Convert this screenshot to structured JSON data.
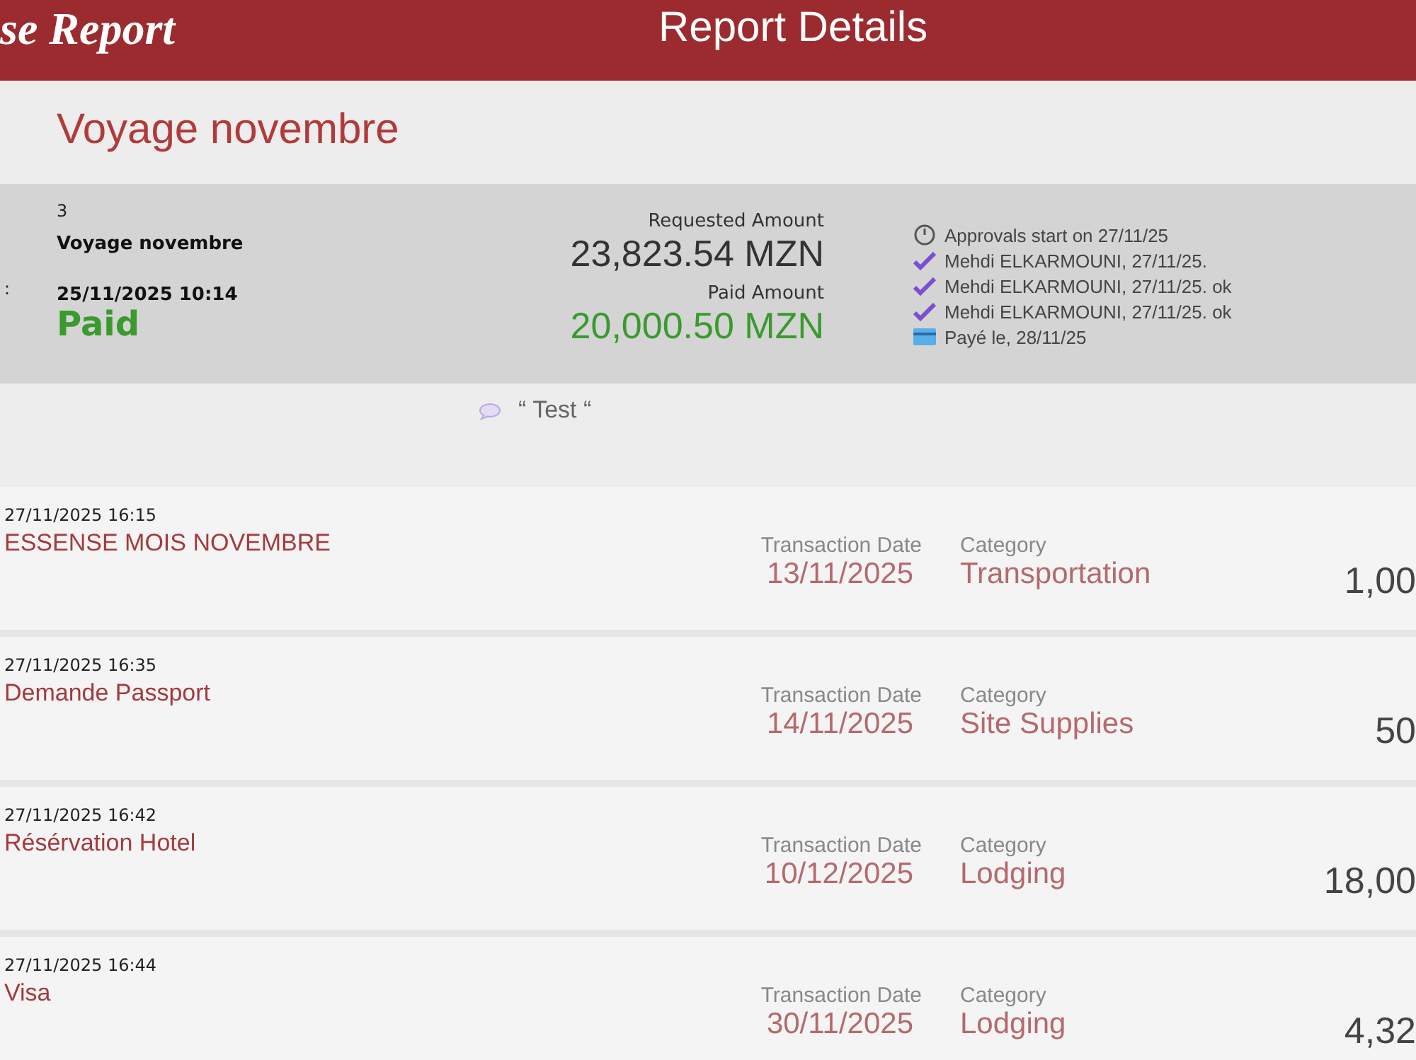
{
  "header": {
    "brand": "se Report",
    "title": "Report Details"
  },
  "report_title": "Voyage novembre",
  "summary": {
    "id": "3",
    "name": "Voyage novembre",
    "date_label": ":",
    "date": "25/11/2025 10:14",
    "status": "Paid",
    "requested_label": "Requested Amount",
    "requested": "23,823.54 MZN",
    "paid_label": "Paid Amount",
    "paid": "20,000.50 MZN",
    "approvals": [
      {
        "kind": "start",
        "text": "Approvals start on 27/11/25"
      },
      {
        "kind": "approved",
        "text": "Mehdi ELKARMOUNI, 27/11/25."
      },
      {
        "kind": "approved",
        "text": "Mehdi ELKARMOUNI, 27/11/25. ok"
      },
      {
        "kind": "approved",
        "text": "Mehdi ELKARMOUNI, 27/11/25. ok"
      },
      {
        "kind": "paid",
        "text": "Payé le, 28/11/25"
      }
    ]
  },
  "comment": "“ Test “",
  "expenses": [
    {
      "created": "27/11/2025 16:15",
      "name": "ESSENSE MOIS NOVEMBRE",
      "date_label": "Transaction Date",
      "date": "13/11/2025",
      "category_label": "Category",
      "category": "Transportation",
      "amount": "1,00"
    },
    {
      "created": "27/11/2025 16:35",
      "name": "Demande Passport",
      "date_label": "Transaction Date",
      "date": "14/11/2025",
      "category_label": "Category",
      "category": "Site Supplies",
      "amount": "50"
    },
    {
      "created": "27/11/2025 16:42",
      "name": "Résérvation Hotel",
      "date_label": "Transaction Date",
      "date": "10/12/2025",
      "category_label": "Category",
      "category": "Lodging",
      "amount": "18,00"
    },
    {
      "created": "27/11/2025 16:44",
      "name": "Visa",
      "date_label": "Transaction Date",
      "date": "30/11/2025",
      "category_label": "Category",
      "category": "Lodging",
      "amount": "4,32"
    }
  ]
}
